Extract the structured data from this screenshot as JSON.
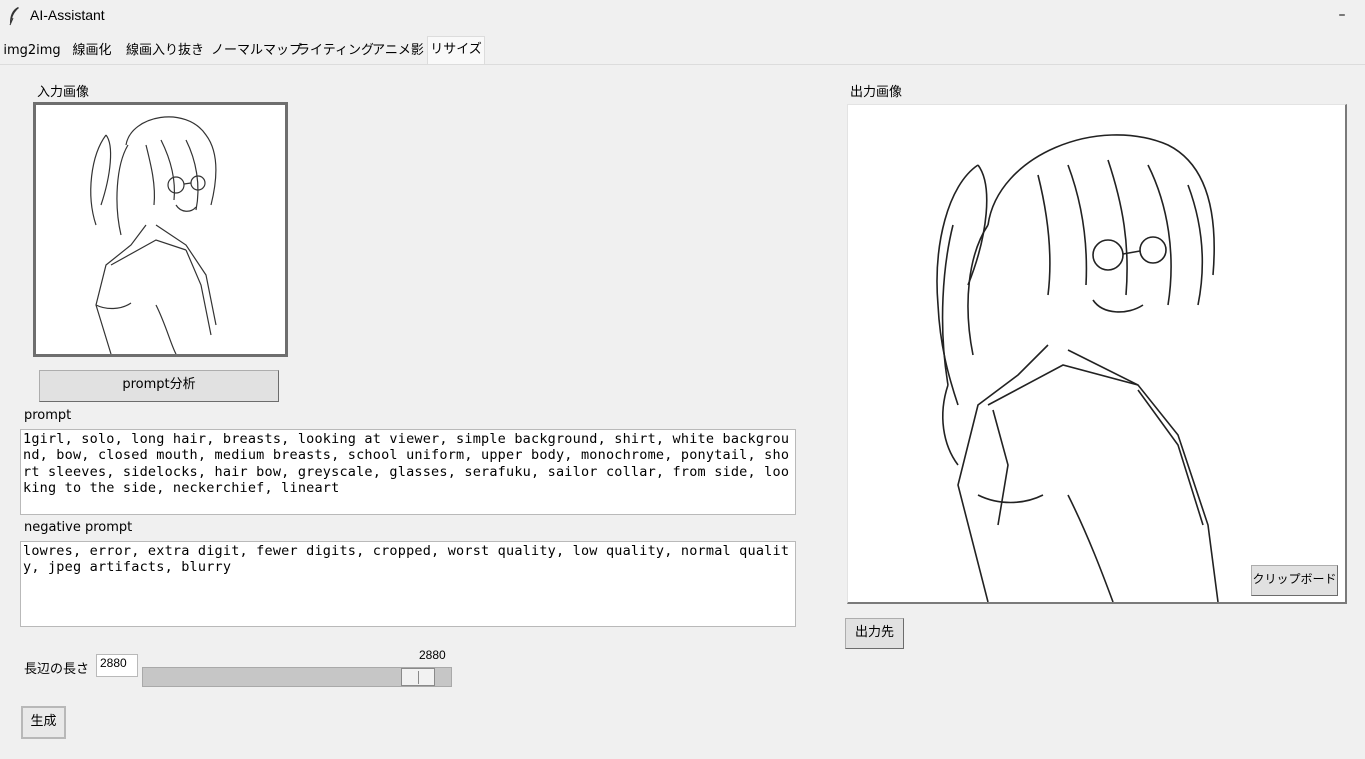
{
  "window": {
    "title": "AI-Assistant",
    "minimize_glyph": "–"
  },
  "tabs": [
    {
      "label": "img2img"
    },
    {
      "label": "線画化"
    },
    {
      "label": "線画入り抜き"
    },
    {
      "label": "ノーマルマップ"
    },
    {
      "label": "ライティング"
    },
    {
      "label": "アニメ影"
    },
    {
      "label": "リサイズ",
      "active": true
    }
  ],
  "input_panel": {
    "label": "入力画像",
    "analyze_button": "prompt分析",
    "prompt_label": "prompt",
    "prompt_value": "1girl, solo, long hair, breasts, looking at viewer, simple background, shirt, white background, bow, closed mouth, medium breasts, school uniform, upper body, monochrome, ponytail, short sleeves, sidelocks, hair bow, greyscale, glasses, serafuku, sailor collar, from side, looking to the side, neckerchief, lineart",
    "negative_label": "negative prompt",
    "negative_value": "lowres, error, extra digit, fewer digits, cropped, worst quality, low quality, normal quality, jpeg artifacts, blurry"
  },
  "resize": {
    "label": "長辺の長さ",
    "value": "2880",
    "slider_value_label": "2880",
    "slider_fraction": 0.94
  },
  "generate_button": "生成",
  "output_panel": {
    "label": "出力画像",
    "clipboard_button": "クリップボード",
    "output_dest_button": "出力先"
  },
  "icons": {
    "app": "feather-icon",
    "minimize": "minimize-icon"
  }
}
